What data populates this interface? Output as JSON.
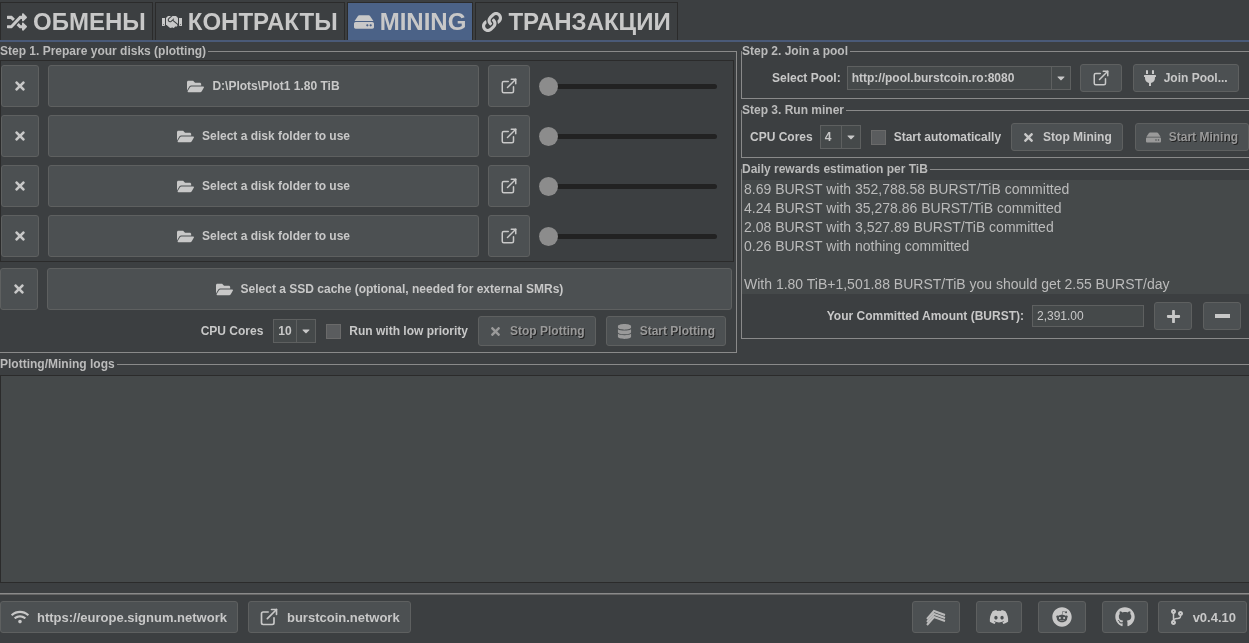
{
  "tabs": [
    {
      "label": "ОБМЕНЫ",
      "selected": false
    },
    {
      "label": "КОНТРАКТЫ",
      "selected": false
    },
    {
      "label": "MINING",
      "selected": true
    },
    {
      "label": "ТРАНЗАКЦИИ",
      "selected": false
    }
  ],
  "plotting": {
    "title": "Step 1. Prepare your disks (plotting)",
    "disks": [
      {
        "label": "D:\\Plots\\Plot1 1.80 TiB",
        "level": 0
      },
      {
        "label": "Select a disk folder to use",
        "level": 0
      },
      {
        "label": "Select a disk folder to use",
        "level": 0
      },
      {
        "label": "Select a disk folder to use",
        "level": 0
      }
    ],
    "ssd_cache": "Select a SSD cache (optional, needed for external SMRs)",
    "cpu_label": "CPU Cores",
    "cpu_value": "10",
    "low_priority": {
      "label": "Run with low priority",
      "checked": false
    },
    "stop_button": {
      "label": "Stop Plotting",
      "disabled": true
    },
    "start_button": {
      "label": "Start Plotting",
      "disabled": true
    }
  },
  "pool": {
    "title": "Step 2. Join a pool",
    "label": "Select Pool:",
    "value": "http://pool.burstcoin.ro:8080",
    "join_button": "Join Pool..."
  },
  "miner": {
    "title": "Step 3. Run miner",
    "cpu_label": "CPU Cores",
    "cpu_value": "4",
    "auto_start": {
      "label": "Start automatically",
      "checked": false
    },
    "stop_button": {
      "label": "Stop Mining",
      "disabled": false
    },
    "start_button": {
      "label": "Start Mining",
      "disabled": true
    }
  },
  "rewards": {
    "title": "Daily rewards estimation per TiB",
    "lines": [
      "8.69 BURST with 352,788.58 BURST/TiB committed",
      "4.24 BURST with 35,278.86 BURST/TiB committed",
      "2.08 BURST with 3,527.89 BURST/TiB committed",
      "0.26 BURST with nothing committed"
    ],
    "summary": "With 1.80 TiB+1,501.88 BURST/TiB you should get 2.55 BURST/day",
    "committed_label": "Your Committed Amount (BURST):",
    "committed_value": "2,391.00"
  },
  "logs": {
    "title": "Plotting/Mining logs"
  },
  "footer": {
    "node": "https://europe.signum.network",
    "site": "burstcoin.network",
    "version": "v0.4.10"
  }
}
